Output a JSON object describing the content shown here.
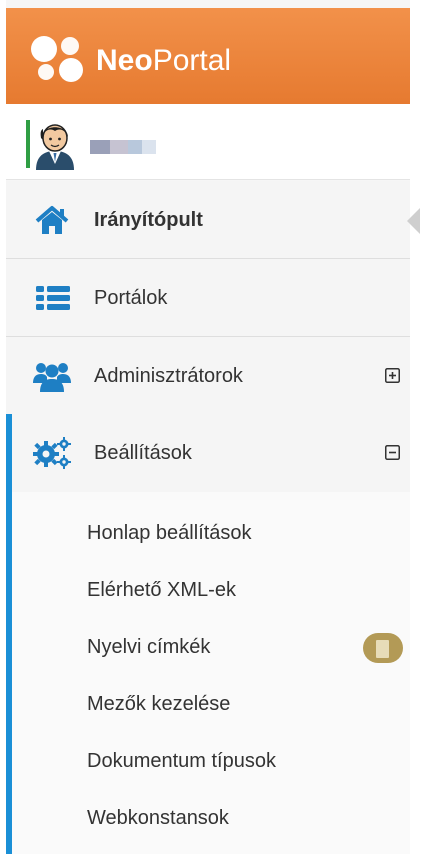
{
  "header": {
    "brand_bold": "Neo",
    "brand_regular": "Portal",
    "color": "#EA7B2E"
  },
  "user": {
    "avatar_icon": "user-avatar-icon",
    "status_color": "#2F9E44"
  },
  "nav": {
    "items": [
      {
        "label": "Irányítópult",
        "icon": "home-icon",
        "active": true
      },
      {
        "label": "Portálok",
        "icon": "list-icon"
      },
      {
        "label": "Adminisztrátorok",
        "icon": "users-icon",
        "toggle": "expand"
      },
      {
        "label": "Beállítások",
        "icon": "cogs-icon",
        "toggle": "collapse",
        "expanded": true
      }
    ],
    "submenu": [
      {
        "label": "Honlap beállítások"
      },
      {
        "label": "Elérhető XML-ek"
      },
      {
        "label": "Nyelvi címkék",
        "badge_icon": "document-icon"
      },
      {
        "label": "Mezők kezelése"
      },
      {
        "label": "Dokumentum típusok"
      },
      {
        "label": "Webkonstansok"
      }
    ],
    "accent_color": "#1A8FD6",
    "icon_color": "#1E7FC4"
  }
}
